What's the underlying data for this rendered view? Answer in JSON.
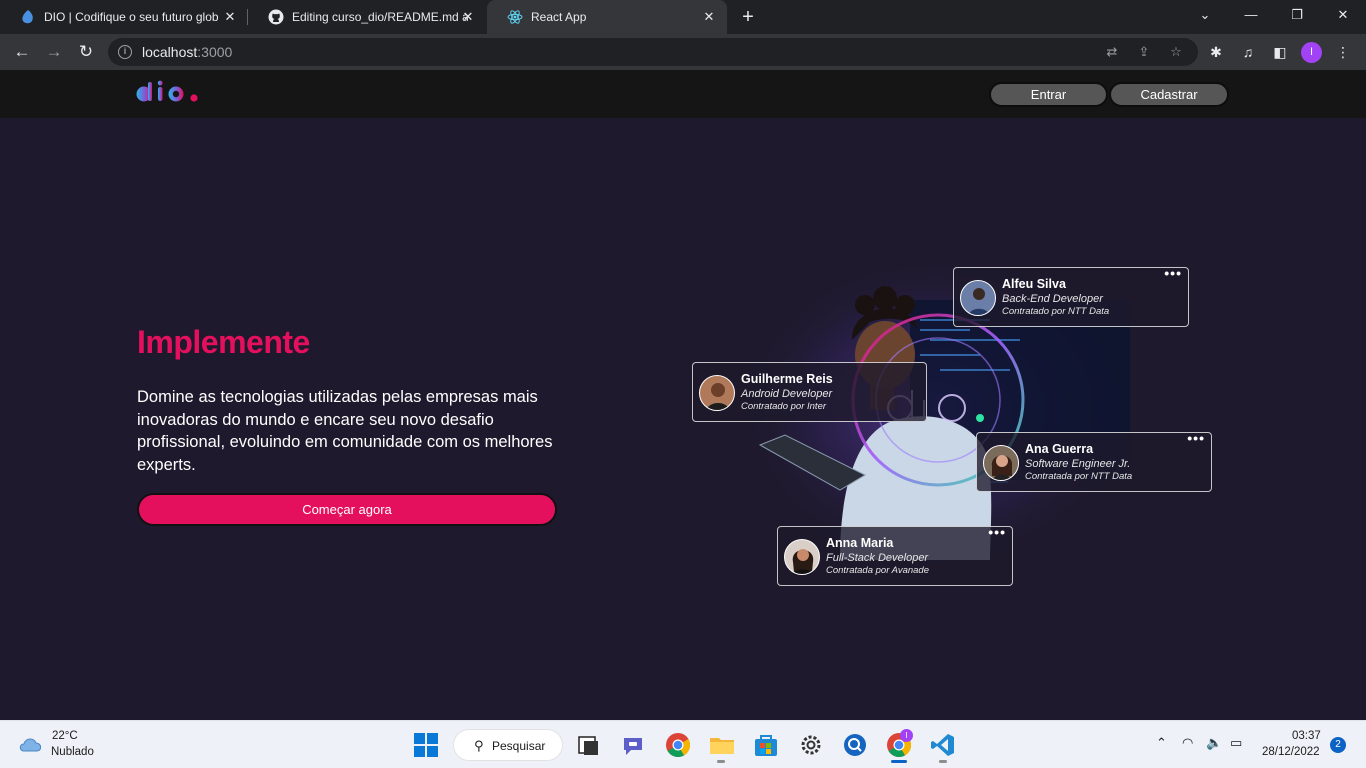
{
  "browser": {
    "tabs": [
      {
        "title": "DIO | Codifique o seu futuro glob",
        "icon": "dio-favicon",
        "active": false
      },
      {
        "title": "Editing curso_dio/README.md at",
        "icon": "github-icon",
        "active": false
      },
      {
        "title": "React App",
        "icon": "react-icon",
        "active": true
      }
    ],
    "url_host": "localhost",
    "url_port": ":3000",
    "profile_initial": "I"
  },
  "header": {
    "login_label": "Entrar",
    "signup_label": "Cadastrar"
  },
  "hero": {
    "title": "Implemente",
    "description": "Domine as tecnologias utilizadas pelas empresas mais inovadoras do mundo e encare seu novo desafio profissional, evoluindo em comunidade com os melhores experts.",
    "cta_label": "Começar agora"
  },
  "testimonials": [
    {
      "name": "Alfeu Silva",
      "role": "Back-End Developer",
      "company": "Contratado por NTT Data"
    },
    {
      "name": "Guilherme Reis",
      "role": "Android Developer",
      "company": "Contratado por Inter"
    },
    {
      "name": "Ana Guerra",
      "role": "Software Engineer Jr.",
      "company": "Contratada por NTT Data"
    },
    {
      "name": "Anna Maria",
      "role": "Full-Stack Developer",
      "company": "Contratada por Avanade"
    }
  ],
  "taskbar": {
    "weather_temp": "22°C",
    "weather_desc": "Nublado",
    "search_label": "Pesquisar",
    "time": "03:37",
    "date": "28/12/2022",
    "notification_count": "2",
    "chrome_badge": "I"
  },
  "colors": {
    "accent": "#e4105d",
    "page_background": "#1e192c",
    "header_background": "#151515"
  }
}
